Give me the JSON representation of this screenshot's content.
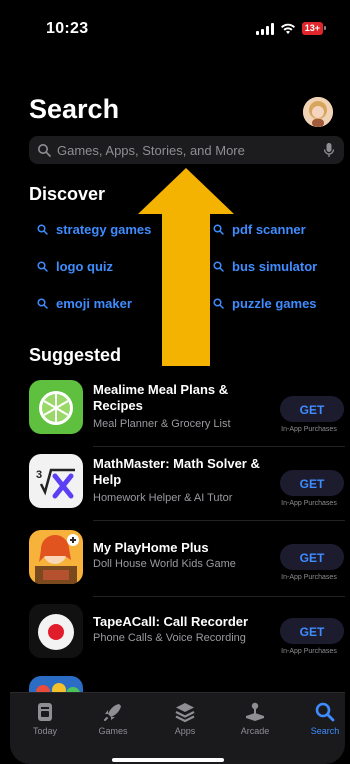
{
  "status": {
    "time": "10:23",
    "battery": "13+"
  },
  "page": {
    "title": "Search"
  },
  "search": {
    "placeholder": "Games, Apps, Stories, and More"
  },
  "discover": {
    "heading": "Discover",
    "items": [
      "strategy games",
      "pdf scanner",
      "logo quiz",
      "bus simulator",
      "emoji maker",
      "puzzle games"
    ]
  },
  "suggested": {
    "heading": "Suggested",
    "apps": [
      {
        "name": "Mealime Meal Plans & Recipes",
        "subtitle": "Meal Planner & Grocery List",
        "button": "GET",
        "note": "In-App Purchases"
      },
      {
        "name": "MathMaster: Math Solver & Help",
        "subtitle": "Homework Helper & AI Tutor",
        "button": "GET",
        "note": "In-App Purchases"
      },
      {
        "name": "My PlayHome Plus",
        "subtitle": "Doll House World Kids Game",
        "button": "GET",
        "note": "In-App Purchases"
      },
      {
        "name": "TapeACall: Call Recorder",
        "subtitle": "Phone Calls & Voice Recording",
        "button": "GET",
        "note": "In-App Purchases"
      }
    ]
  },
  "tabs": [
    {
      "label": "Today",
      "icon": "today-icon"
    },
    {
      "label": "Games",
      "icon": "rocket-icon"
    },
    {
      "label": "Apps",
      "icon": "layers-icon"
    },
    {
      "label": "Arcade",
      "icon": "joystick-icon"
    },
    {
      "label": "Search",
      "icon": "search-icon",
      "active": true
    }
  ],
  "colors": {
    "accent": "#3f8cff",
    "arrow": "#f5b301",
    "background": "#000000"
  }
}
